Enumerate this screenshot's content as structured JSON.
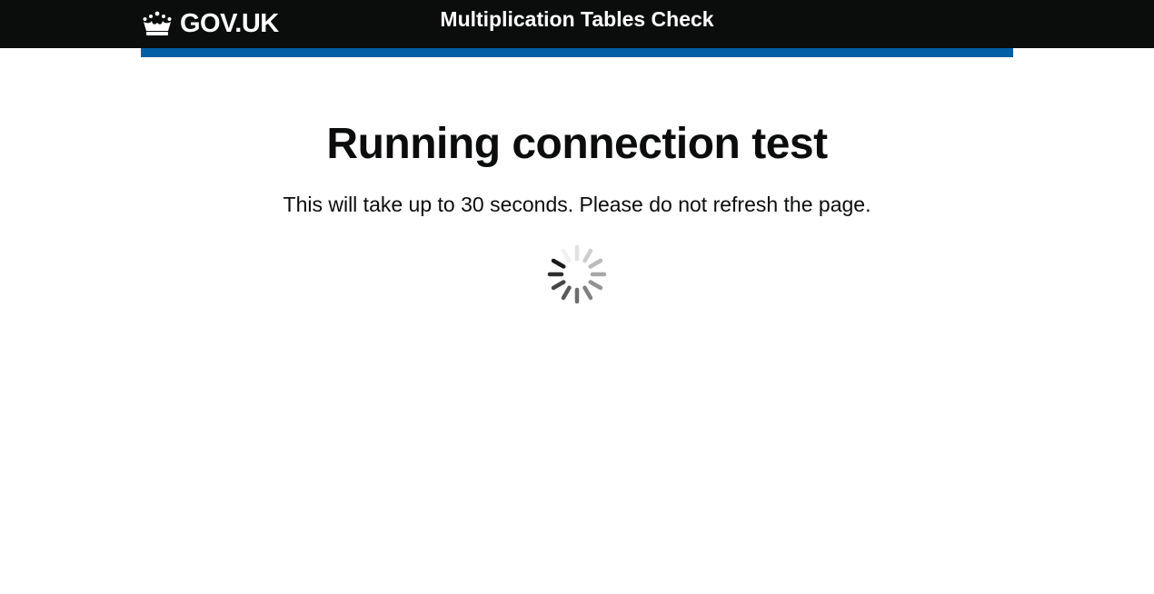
{
  "header": {
    "logo_text": "GOV.UK",
    "service_name": "Multiplication Tables Check"
  },
  "main": {
    "title": "Running connection test",
    "lede": "This will take up to 30 seconds. Please do not refresh the page."
  },
  "icons": {
    "logo": "crown-icon",
    "loading": "loading-spinner-icon"
  },
  "colors": {
    "header_background": "#0b0c0c",
    "header_text": "#ffffff",
    "accent_bar": "#005ea5",
    "body_text": "#0b0c0c",
    "spinner": "#0b0c0c"
  }
}
